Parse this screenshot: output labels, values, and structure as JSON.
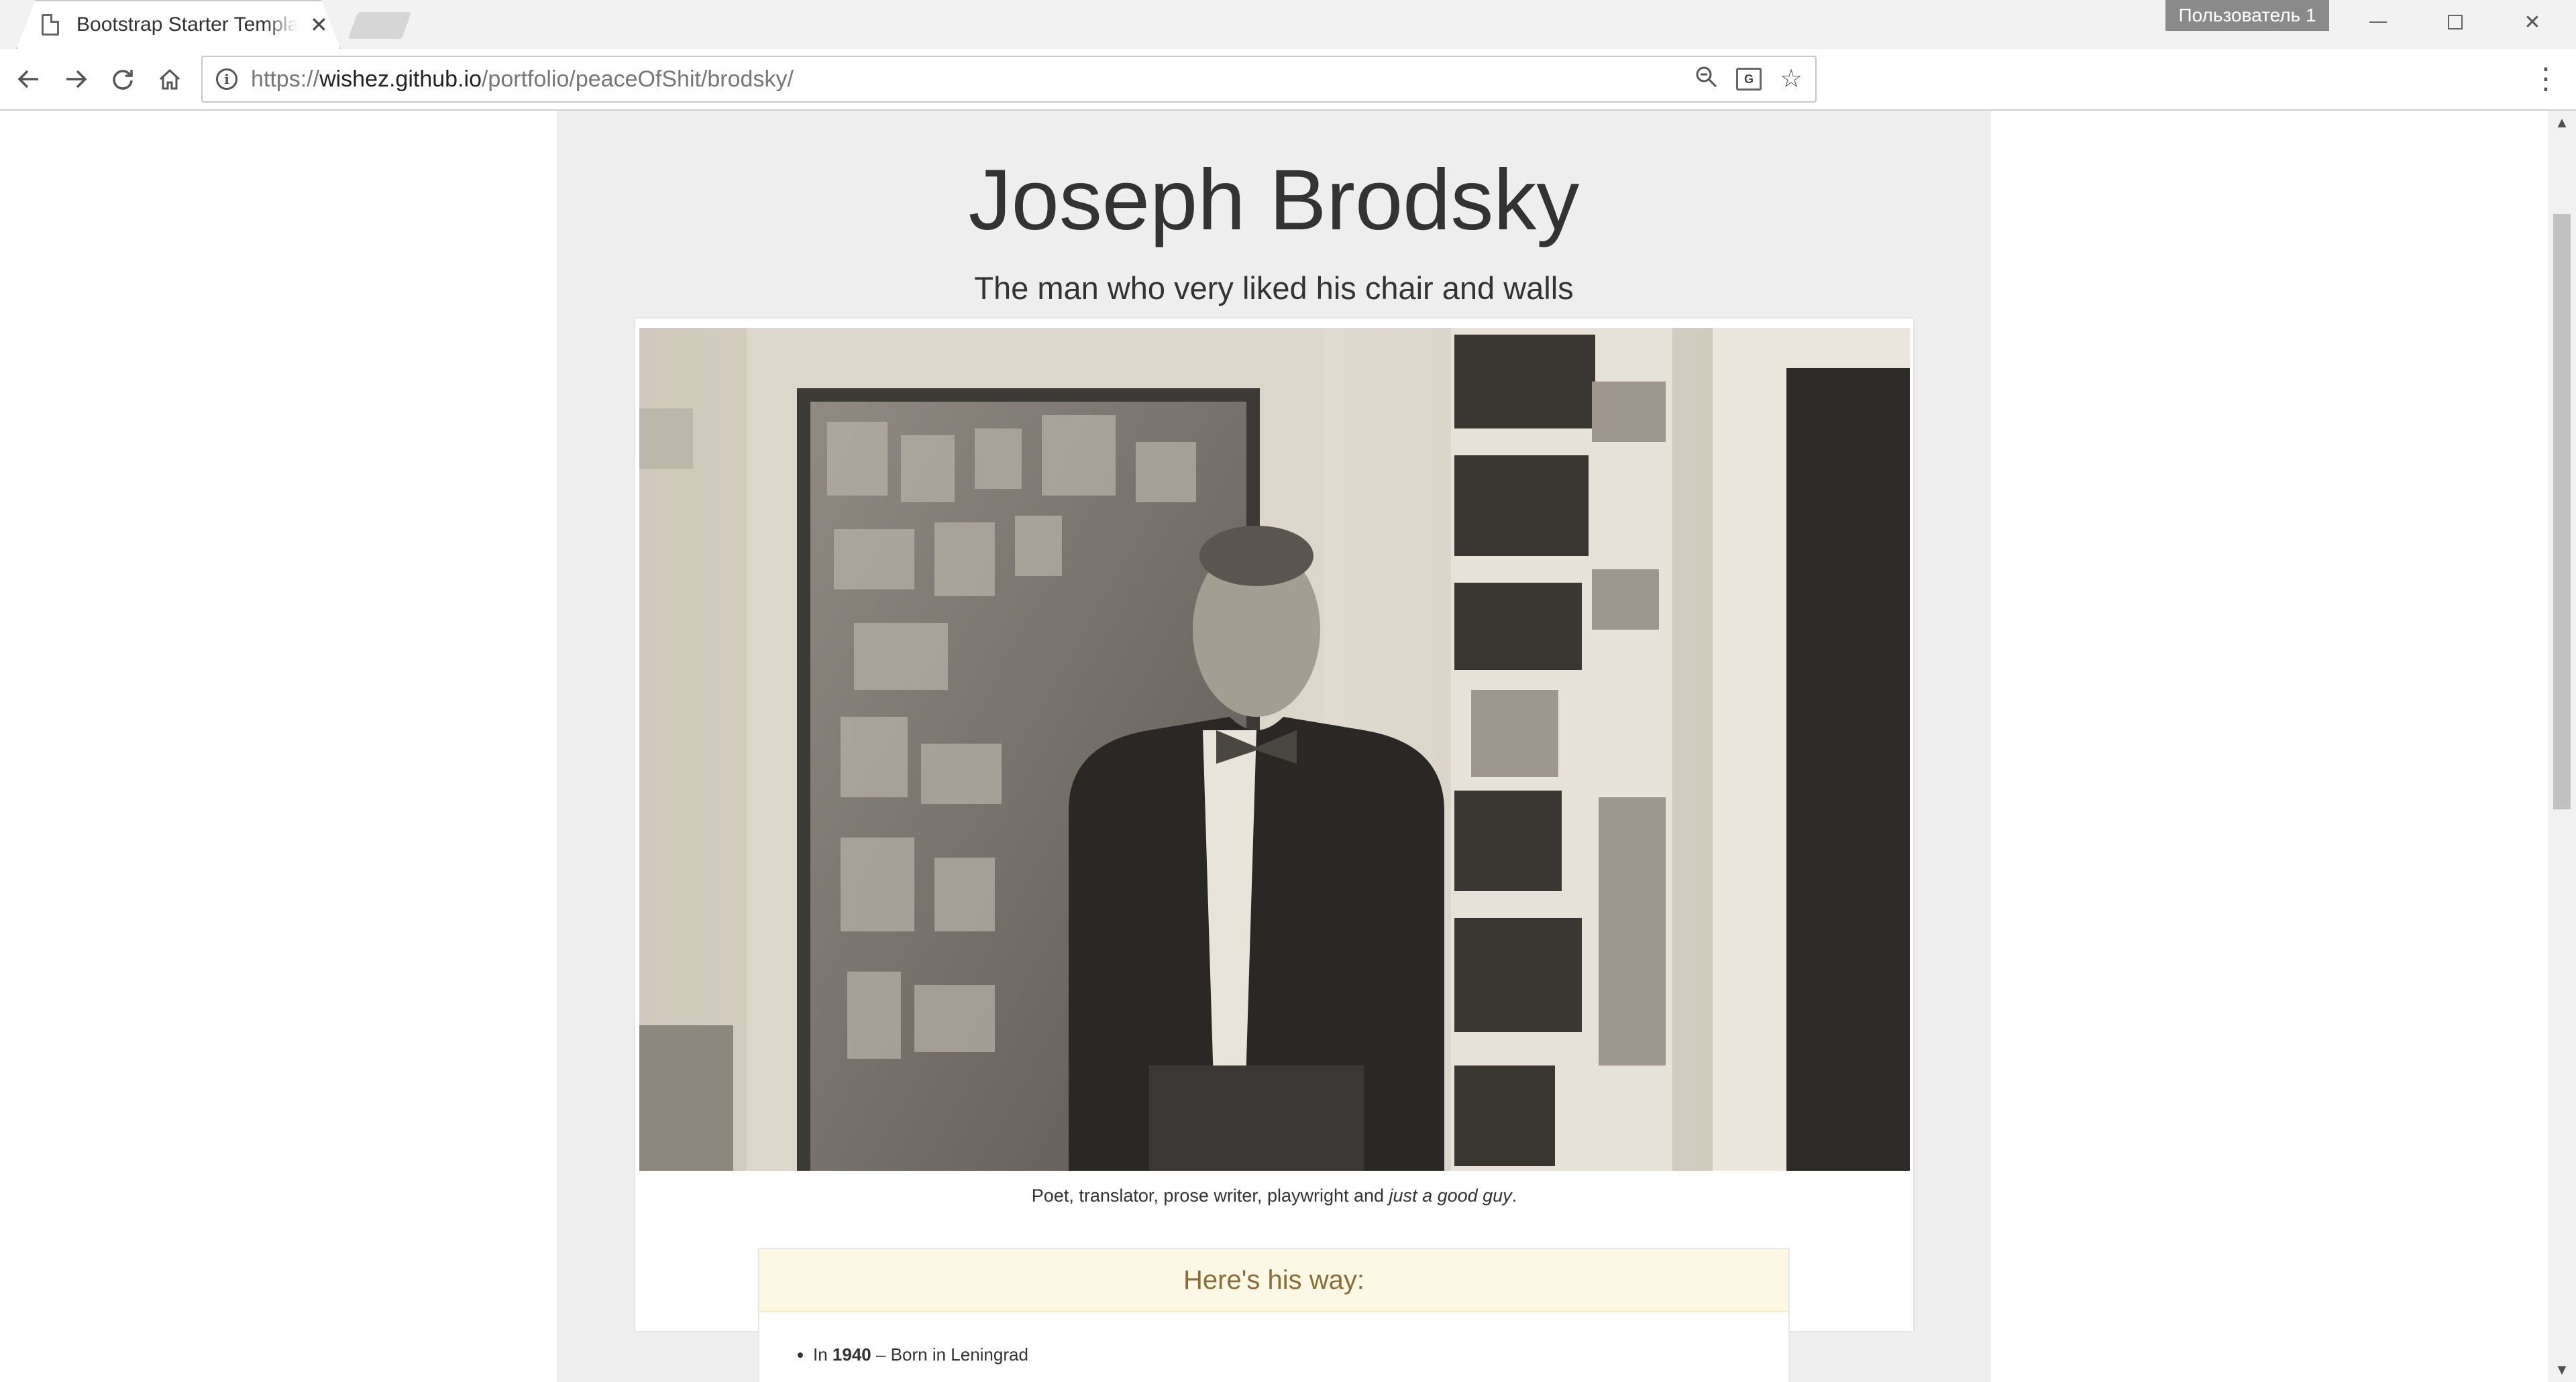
{
  "browser": {
    "tab_title": "Bootstrap Starter Template",
    "tab_close": "✕",
    "profile_name": "Пользователь 1",
    "url_scheme": "https://",
    "url_host": "wishez.github.io",
    "url_path": "/portfolio/peaceOfShit/brodsky/",
    "icons": {
      "back": "back-arrow-icon",
      "forward": "forward-arrow-icon",
      "reload": "reload-icon",
      "home": "home-icon",
      "info": "info-icon",
      "zoom": "zoom-icon",
      "translate": "translate-icon",
      "bookmark": "star-icon",
      "menu": "kebab-menu-icon"
    }
  },
  "page": {
    "title": "Joseph Brodsky",
    "subtitle": "The man who very liked his chair and walls",
    "caption_start": "Poet, translator, prose writer, playwright and ",
    "caption_em": "just a good guy",
    "caption_end": ".",
    "way_heading": "Here's his way:",
    "timeline": [
      {
        "prefix": "In ",
        "year": "1940",
        "text": " – Born in Leningrad"
      }
    ]
  },
  "colors": {
    "column_bg": "#eeeeee",
    "panel_header_bg": "#fcf8e3",
    "panel_header_text": "#8a6d3b"
  }
}
